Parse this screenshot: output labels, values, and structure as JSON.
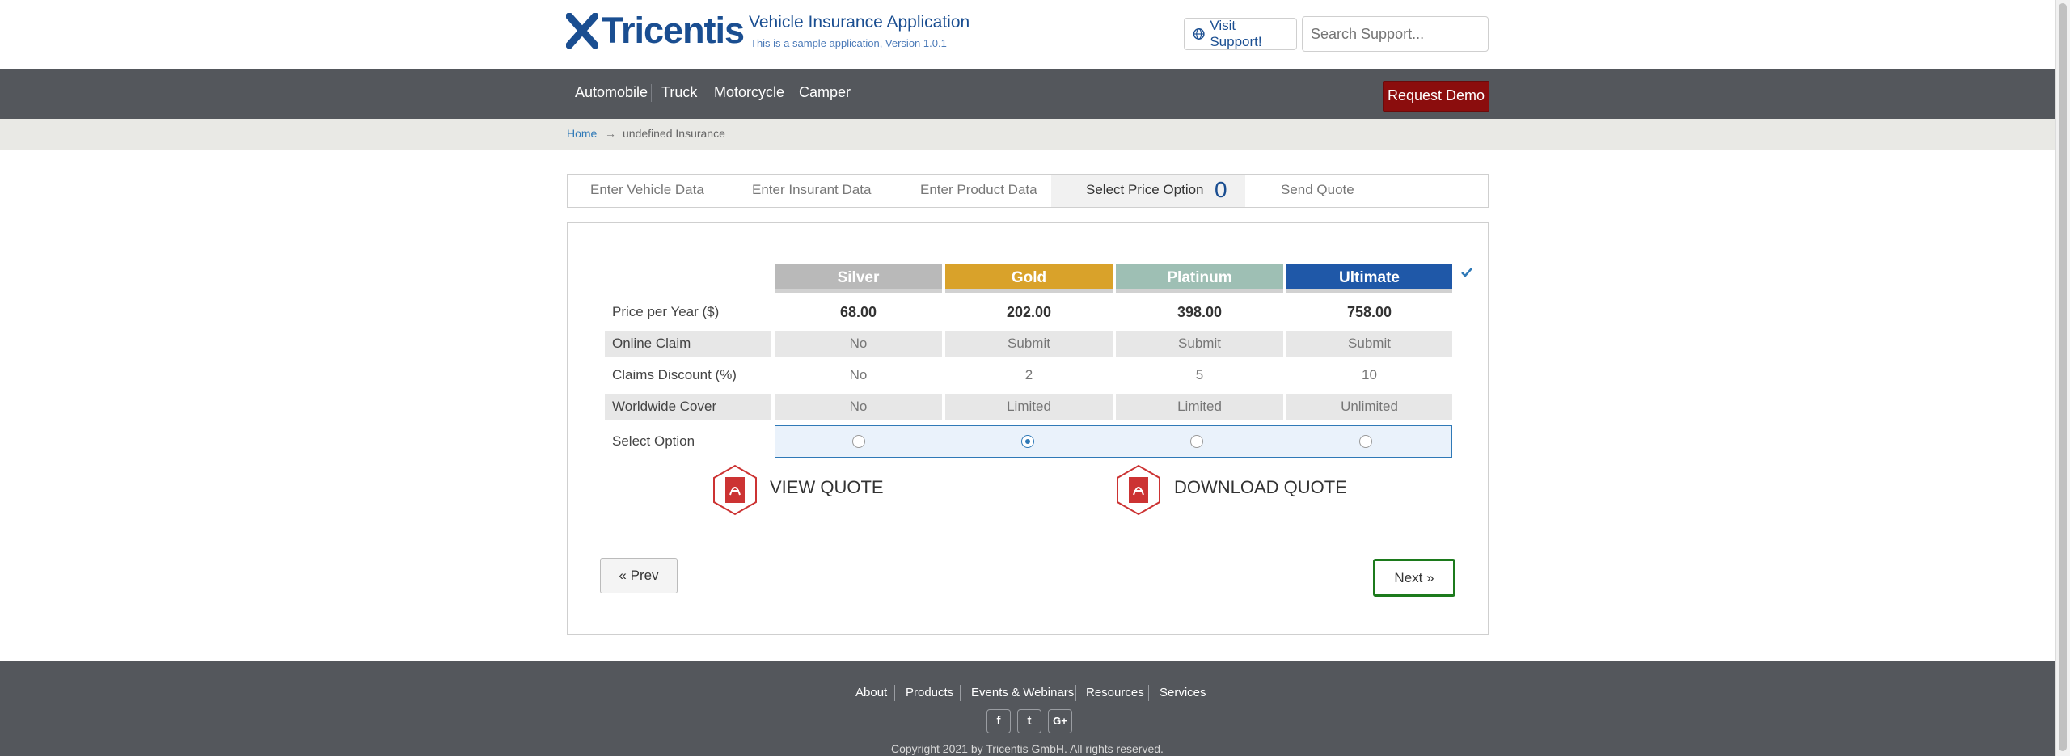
{
  "header": {
    "logo_text": "Tricentis",
    "app_title": "Vehicle Insurance Application",
    "app_subtitle": "This is a sample application, Version 1.0.1",
    "visit_support_label": "Visit Support!",
    "search_placeholder": "Search Support..."
  },
  "nav": {
    "items": [
      "Automobile",
      "Truck",
      "Motorcycle",
      "Camper"
    ],
    "request_demo_label": "Request Demo"
  },
  "breadcrumb": {
    "home": "Home",
    "arrow": "→",
    "current": "undefined Insurance"
  },
  "wizard": {
    "tabs": [
      "Enter Vehicle Data",
      "Enter Insurant Data",
      "Enter Product Data",
      "Select Price Option",
      "Send Quote"
    ],
    "active_index": 3,
    "active_count": "0"
  },
  "price_table": {
    "columns": [
      {
        "name": "Silver",
        "color": "#b9b9b9"
      },
      {
        "name": "Gold",
        "color": "#d9a22a"
      },
      {
        "name": "Platinum",
        "color": "#9ebfb4"
      },
      {
        "name": "Ultimate",
        "color": "#1f58a8"
      }
    ],
    "rows": [
      {
        "label": "Price per Year ($)",
        "values": [
          "68.00",
          "202.00",
          "398.00",
          "758.00"
        ]
      },
      {
        "label": "Online Claim",
        "values": [
          "No",
          "Submit",
          "Submit",
          "Submit"
        ]
      },
      {
        "label": "Claims Discount (%)",
        "values": [
          "No",
          "2",
          "5",
          "10"
        ]
      },
      {
        "label": "Worldwide Cover",
        "values": [
          "No",
          "Limited",
          "Limited",
          "Unlimited"
        ]
      }
    ],
    "select_label": "Select Option",
    "selected_index": 1
  },
  "actions": {
    "view_quote": "VIEW QUOTE",
    "download_quote": "DOWNLOAD QUOTE",
    "prev": "« Prev",
    "next": "Next »"
  },
  "footer": {
    "links": [
      "About",
      "Products",
      "Events & Webinars",
      "Resources",
      "Services"
    ],
    "social": [
      "f",
      "t",
      "G+"
    ],
    "copyright": "Copyright 2021 by Tricentis GmbH. All rights reserved."
  }
}
